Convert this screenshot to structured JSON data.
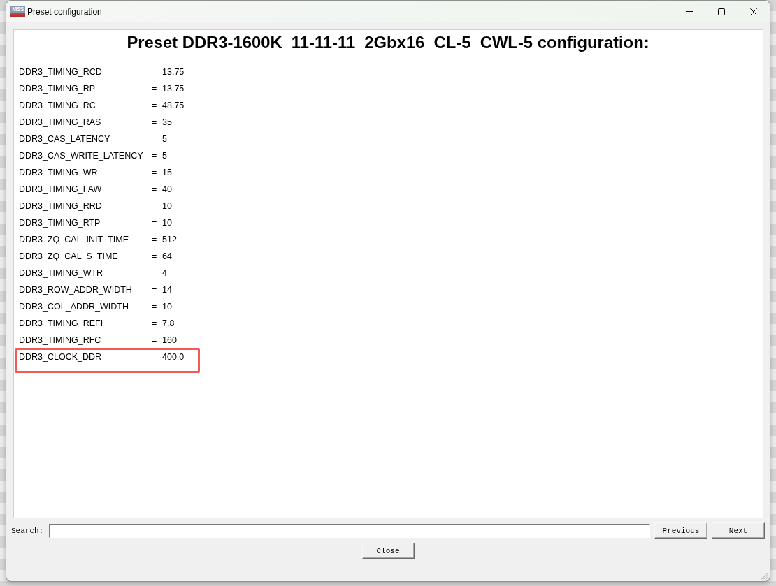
{
  "window": {
    "title": "Preset configuration",
    "icon_label": "MSS"
  },
  "heading": "Preset DDR3-1600K_11-11-11_2Gbx16_CL-5_CWL-5 configuration:",
  "parameters": [
    {
      "name": "DDR3_TIMING_RCD",
      "separator": "=",
      "value": "13.75",
      "highlighted": false
    },
    {
      "name": "DDR3_TIMING_RP",
      "separator": "=",
      "value": "13.75",
      "highlighted": false
    },
    {
      "name": "DDR3_TIMING_RC",
      "separator": "=",
      "value": "48.75",
      "highlighted": false
    },
    {
      "name": "DDR3_TIMING_RAS",
      "separator": "=",
      "value": "35",
      "highlighted": false
    },
    {
      "name": "DDR3_CAS_LATENCY",
      "separator": "=",
      "value": "5",
      "highlighted": false
    },
    {
      "name": "DDR3_CAS_WRITE_LATENCY",
      "separator": "=",
      "value": "5",
      "highlighted": false
    },
    {
      "name": "DDR3_TIMING_WR",
      "separator": "=",
      "value": "15",
      "highlighted": false
    },
    {
      "name": "DDR3_TIMING_FAW",
      "separator": "=",
      "value": "40",
      "highlighted": false
    },
    {
      "name": "DDR3_TIMING_RRD",
      "separator": "=",
      "value": "10",
      "highlighted": false
    },
    {
      "name": "DDR3_TIMING_RTP",
      "separator": "=",
      "value": "10",
      "highlighted": false
    },
    {
      "name": "DDR3_ZQ_CAL_INIT_TIME",
      "separator": "=",
      "value": "512",
      "highlighted": false
    },
    {
      "name": "DDR3_ZQ_CAL_S_TIME",
      "separator": "=",
      "value": "64",
      "highlighted": false
    },
    {
      "name": "DDR3_TIMING_WTR",
      "separator": "=",
      "value": "4",
      "highlighted": false
    },
    {
      "name": "DDR3_ROW_ADDR_WIDTH",
      "separator": "=",
      "value": "14",
      "highlighted": false
    },
    {
      "name": "DDR3_COL_ADDR_WIDTH",
      "separator": "=",
      "value": "10",
      "highlighted": false
    },
    {
      "name": "DDR3_TIMING_REFI",
      "separator": "=",
      "value": "7.8",
      "highlighted": false
    },
    {
      "name": "DDR3_TIMING_RFC",
      "separator": "=",
      "value": "160",
      "highlighted": false
    },
    {
      "name": "DDR3_CLOCK_DDR",
      "separator": "=",
      "value": "400.0",
      "highlighted": true
    }
  ],
  "search": {
    "label": "Search:",
    "buttons": [
      {
        "label": "Previous"
      },
      {
        "label": "Next"
      }
    ]
  },
  "close_button": {
    "label": "Close"
  }
}
